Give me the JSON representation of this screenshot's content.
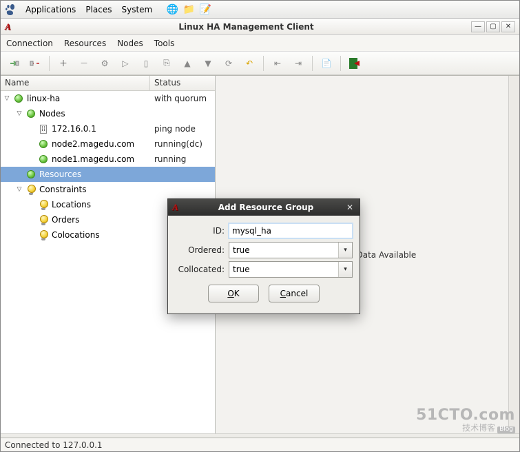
{
  "os_panel": {
    "menus": [
      "Applications",
      "Places",
      "System"
    ]
  },
  "window": {
    "title": "Linux HA Management Client",
    "menubar": [
      "Connection",
      "Resources",
      "Nodes",
      "Tools"
    ]
  },
  "tree": {
    "columns": {
      "name": "Name",
      "status": "Status"
    },
    "rows": [
      {
        "indent": 1,
        "expander": "▽",
        "icon": "dot-green",
        "label": "linux-ha",
        "status": "with quorum",
        "selected": false
      },
      {
        "indent": 2,
        "expander": "▽",
        "icon": "dot-green",
        "label": "Nodes",
        "status": "",
        "selected": false
      },
      {
        "indent": 3,
        "expander": "",
        "icon": "ping",
        "label": "172.16.0.1",
        "status": "ping node",
        "selected": false
      },
      {
        "indent": 3,
        "expander": "",
        "icon": "dot-green",
        "label": "node2.magedu.com",
        "status": "running(dc)",
        "selected": false
      },
      {
        "indent": 3,
        "expander": "",
        "icon": "dot-green",
        "label": "node1.magedu.com",
        "status": "running",
        "selected": false
      },
      {
        "indent": 2,
        "expander": "",
        "icon": "dot-green",
        "label": "Resources",
        "status": "",
        "selected": true
      },
      {
        "indent": 2,
        "expander": "▽",
        "icon": "bulb",
        "label": "Constraints",
        "status": "",
        "selected": false
      },
      {
        "indent": 3,
        "expander": "",
        "icon": "bulb",
        "label": "Locations",
        "status": "",
        "selected": false
      },
      {
        "indent": 3,
        "expander": "",
        "icon": "bulb",
        "label": "Orders",
        "status": "",
        "selected": false
      },
      {
        "indent": 3,
        "expander": "",
        "icon": "bulb",
        "label": "Colocations",
        "status": "",
        "selected": false
      }
    ]
  },
  "detail": {
    "text": "No Meta Data Available"
  },
  "dialog": {
    "title": "Add Resource Group",
    "fields": {
      "id_label": "ID:",
      "id_value": "mysql_ha",
      "ordered_label": "Ordered:",
      "ordered_value": "true",
      "collocated_label": "Collocated:",
      "collocated_value": "true"
    },
    "buttons": {
      "ok": "OK",
      "cancel": "Cancel"
    }
  },
  "statusbar": {
    "text": "Connected to 127.0.0.1"
  },
  "watermark": {
    "big": "51CTO.com",
    "small": "技术博客",
    "tag": "Blog"
  }
}
